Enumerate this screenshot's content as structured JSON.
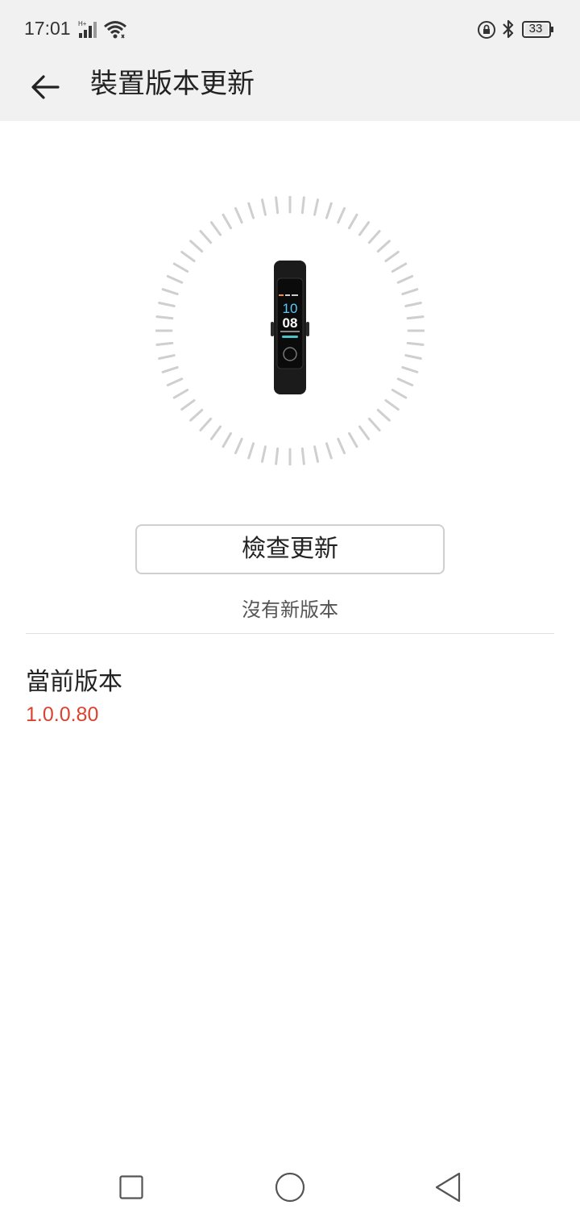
{
  "status_bar": {
    "time": "17:01",
    "battery_level": "33",
    "icons": [
      "signal-icon",
      "wifi-icon",
      "rotation-lock-icon",
      "bluetooth-icon",
      "battery-icon"
    ]
  },
  "header": {
    "title": "裝置版本更新",
    "back_icon": "arrow-left-icon"
  },
  "device": {
    "image": "fitness-band",
    "screen_hour": "10",
    "screen_minute": "08"
  },
  "update": {
    "check_button_label": "檢查更新",
    "status_text": "沒有新版本"
  },
  "current_version": {
    "label": "當前版本",
    "value": "1.0.0.80"
  },
  "colors": {
    "accent": "#d9432f",
    "bar_bg": "#f1f1f1"
  },
  "nav_bar": {
    "icons": [
      "recent-apps-icon",
      "home-icon",
      "back-icon"
    ]
  }
}
